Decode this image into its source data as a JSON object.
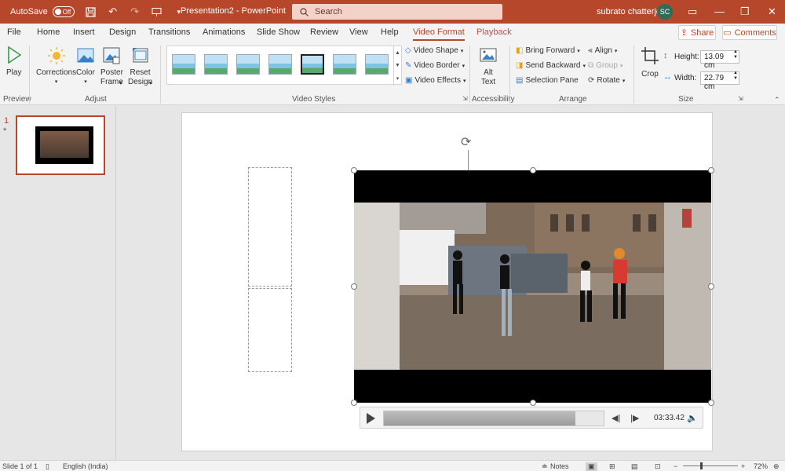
{
  "titlebar": {
    "autosave_label": "AutoSave",
    "autosave_state": "Off",
    "doc_title": "Presentation2  -  PowerPoint",
    "search_placeholder": "Search",
    "user_name": "subrato chatterjee",
    "user_initials": "SC",
    "accent_color": "#b7472a"
  },
  "tabs": [
    {
      "label": "File"
    },
    {
      "label": "Home"
    },
    {
      "label": "Insert"
    },
    {
      "label": "Design"
    },
    {
      "label": "Transitions"
    },
    {
      "label": "Animations"
    },
    {
      "label": "Slide Show"
    },
    {
      "label": "Review"
    },
    {
      "label": "View"
    },
    {
      "label": "Help"
    },
    {
      "label": "Video Format"
    },
    {
      "label": "Playback"
    }
  ],
  "share_label": "Share",
  "comments_label": "Comments",
  "ribbon": {
    "groups": {
      "preview": "Preview",
      "adjust": "Adjust",
      "video_styles": "Video Styles",
      "accessibility": "Accessibility",
      "arrange": "Arrange",
      "size": "Size"
    },
    "play": "Play",
    "corrections": "Corrections",
    "color": "Color",
    "poster_frame_1": "Poster",
    "poster_frame_2": "Frame",
    "reset_design_1": "Reset",
    "reset_design_2": "Design",
    "video_shape": "Video Shape",
    "video_border": "Video Border",
    "video_effects": "Video Effects",
    "alt_text_1": "Alt",
    "alt_text_2": "Text",
    "bring_forward": "Bring Forward",
    "send_backward": "Send Backward",
    "selection_pane": "Selection Pane",
    "align": "Align",
    "group": "Group",
    "rotate": "Rotate",
    "crop": "Crop",
    "height_label": "Height:",
    "height_value": "13.09 cm",
    "width_label": "Width:",
    "width_value": "22.79 cm"
  },
  "thumbnails": {
    "slide_number": "1",
    "star": "*"
  },
  "media": {
    "timecode": "03:33.42",
    "progress": 0.87
  },
  "status": {
    "slide_counter": "Slide 1 of 1",
    "language": "English (India)",
    "notes": "Notes",
    "zoom": "72%"
  }
}
